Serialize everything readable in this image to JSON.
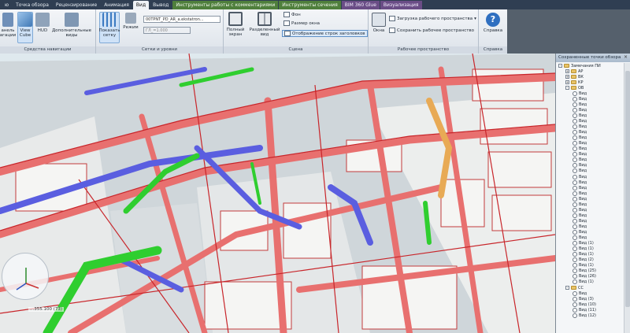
{
  "tabs": [
    {
      "label": "ю",
      "style": "normal"
    },
    {
      "label": "Точка обзора",
      "style": "normal"
    },
    {
      "label": "Рецензирование",
      "style": "normal"
    },
    {
      "label": "Анимация",
      "style": "normal"
    },
    {
      "label": "Вид",
      "style": "active"
    },
    {
      "label": "Вывод",
      "style": "normal"
    },
    {
      "label": "Инструменты работы с комментариями",
      "style": "ctx-green"
    },
    {
      "label": "Инструменты сечения",
      "style": "ctx-green"
    },
    {
      "label": "BIM 360 Glue",
      "style": "ctx-purple"
    },
    {
      "label": "Визуализация",
      "style": "ctx-purple"
    }
  ],
  "ribbon": {
    "nav_panel": {
      "title": "Средства навигации",
      "btn_nav_bar": "анель\nагации",
      "btn_viewcube": "View\nCube",
      "btn_hud": "HUD",
      "btn_extra_views": "Дополнительные\nвиды"
    },
    "grid_panel": {
      "title": "Сетки и уровни",
      "btn_show_grid": "Показать\nсетку",
      "btn_mode": "Режим",
      "combo_model": "00TPNT_PD_AR_a.ekstatron...",
      "combo_level": "ГЛ_=1.000"
    },
    "scene_panel": {
      "title": "Сцена",
      "btn_fullscreen": "Полный\nэкран",
      "btn_split_view": "Разделенный\nвид",
      "item_background": "Фон",
      "item_window_size": "Размер окна",
      "item_show_titles": "Отображение строк заголовков"
    },
    "workspace_panel": {
      "title": "Рабочее пространство",
      "btn_windows": "Окна",
      "item_load_workspace": "Загрузка рабочего пространства",
      "item_save_workspace": "Сохранить рабочее пространство"
    },
    "help_panel": {
      "title": "Справка",
      "btn_help": "Справка"
    }
  },
  "pane": {
    "title": "Сохраненные точки обзора",
    "close": "×",
    "tree": [
      {
        "level": 0,
        "type": "folder",
        "toggle": "-",
        "label": "Замечания ПИ"
      },
      {
        "level": 1,
        "type": "folder",
        "toggle": "+",
        "label": "АР"
      },
      {
        "level": 1,
        "type": "folder",
        "toggle": "+",
        "label": "ВК"
      },
      {
        "level": 1,
        "type": "folder",
        "toggle": "+",
        "label": "КР"
      },
      {
        "level": 1,
        "type": "folder",
        "toggle": "-",
        "label": "ОВ"
      },
      {
        "level": 2,
        "type": "view",
        "label": "Вид"
      },
      {
        "level": 2,
        "type": "view",
        "label": "Вид"
      },
      {
        "level": 2,
        "type": "view",
        "label": "Вид"
      },
      {
        "level": 2,
        "type": "view",
        "label": "Вид"
      },
      {
        "level": 2,
        "type": "view",
        "label": "Вид"
      },
      {
        "level": 2,
        "type": "view",
        "label": "Вид"
      },
      {
        "level": 2,
        "type": "view",
        "label": "Вид"
      },
      {
        "level": 2,
        "type": "view",
        "label": "Вид"
      },
      {
        "level": 2,
        "type": "view",
        "label": "Вид"
      },
      {
        "level": 2,
        "type": "view",
        "label": "Вид"
      },
      {
        "level": 2,
        "type": "view",
        "label": "Вид"
      },
      {
        "level": 2,
        "type": "view",
        "label": "Вид"
      },
      {
        "level": 2,
        "type": "view",
        "label": "Вид"
      },
      {
        "level": 2,
        "type": "view",
        "label": "Вид"
      },
      {
        "level": 2,
        "type": "view",
        "label": "Вид"
      },
      {
        "level": 2,
        "type": "view",
        "label": "Вид"
      },
      {
        "level": 2,
        "type": "view",
        "label": "Вид"
      },
      {
        "level": 2,
        "type": "view",
        "label": "Вид"
      },
      {
        "level": 2,
        "type": "view",
        "label": "Вид"
      },
      {
        "level": 2,
        "type": "view",
        "label": "Вид"
      },
      {
        "level": 2,
        "type": "view",
        "label": "Вид"
      },
      {
        "level": 2,
        "type": "view",
        "label": "Вид"
      },
      {
        "level": 2,
        "type": "view",
        "label": "Вид"
      },
      {
        "level": 2,
        "type": "view",
        "label": "Вид"
      },
      {
        "level": 2,
        "type": "view",
        "label": "Вид"
      },
      {
        "level": 2,
        "type": "view",
        "label": "Вид"
      },
      {
        "level": 2,
        "type": "view",
        "label": "Вид"
      },
      {
        "level": 2,
        "type": "view",
        "label": "Вид (1)"
      },
      {
        "level": 2,
        "type": "view",
        "label": "Вид (1)"
      },
      {
        "level": 2,
        "type": "view",
        "label": "Вид (1)"
      },
      {
        "level": 2,
        "type": "view",
        "label": "Вид (2)"
      },
      {
        "level": 2,
        "type": "view",
        "label": "Вид (1)"
      },
      {
        "level": 2,
        "type": "view",
        "label": "Вид (25)"
      },
      {
        "level": 2,
        "type": "view",
        "label": "Вид (26)"
      },
      {
        "level": 2,
        "type": "view",
        "label": "Вид (1)"
      },
      {
        "level": 1,
        "type": "folder",
        "toggle": "-",
        "label": "СС"
      },
      {
        "level": 2,
        "type": "view",
        "label": "Вид"
      },
      {
        "level": 2,
        "type": "view",
        "label": "Вид (3)"
      },
      {
        "level": 2,
        "type": "view",
        "label": "Вид (10)"
      },
      {
        "level": 2,
        "type": "view",
        "label": "Вид (11)"
      },
      {
        "level": 2,
        "type": "view",
        "label": "Вид (12)"
      }
    ]
  },
  "status": {
    "coords": "...355.100 (73)"
  },
  "colors": {
    "duct_red": "#e8706f",
    "duct_red_edge": "#c8252a",
    "duct_blue": "#5a5ee0",
    "pipe_green": "#2fce2f",
    "duct_orange": "#e8aa55",
    "wall_white": "#f4f4f2",
    "floor_grey": "#c9ced1"
  }
}
